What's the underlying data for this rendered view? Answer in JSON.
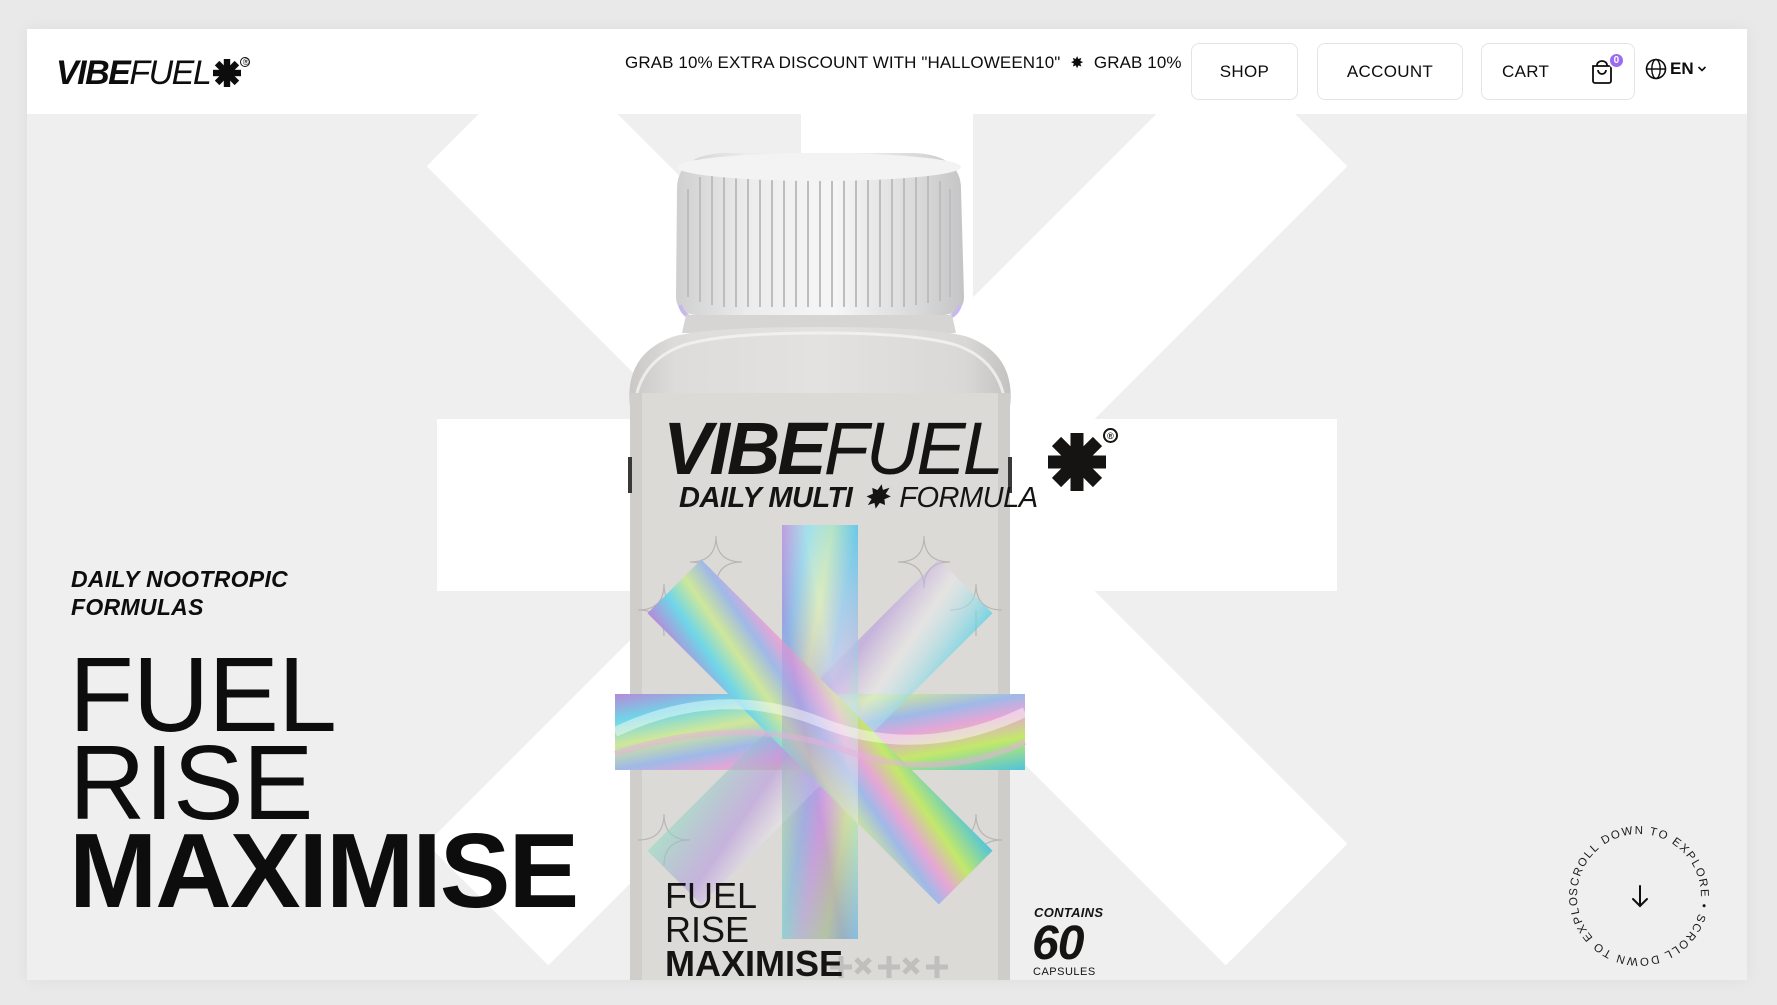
{
  "brand": {
    "logo_bold": "VIBE",
    "logo_light": "FUEL",
    "logo_mark": "asterisk-icon"
  },
  "header": {
    "ticker": [
      "GRAB 10% EXTRA DISCOUNT WITH \"HALLOWEEN10\"",
      "GRAB 10%"
    ],
    "nav": {
      "shop": "SHOP",
      "account": "ACCOUNT",
      "cart": "CART",
      "cart_count": "0"
    },
    "language": "EN"
  },
  "hero": {
    "eyebrow_line1": "DAILY NOOTROPIC",
    "eyebrow_line2": "FORMULAS",
    "headline": [
      "FUEL",
      "RISE",
      "MAXIMISE"
    ]
  },
  "product_label": {
    "brand_bold": "VIBE",
    "brand_light": "FUEL",
    "sub_bold": "DAILY MULTI",
    "sub_light": "FORMULA",
    "tagline": [
      "FUEL",
      "RISE",
      "MAXIMISE"
    ],
    "contains": "CONTAINS",
    "count": "60",
    "unit": "CAPSULES"
  },
  "scroll": {
    "text": "SCROLL DOWN TO EXPLORE • SCROLL DOWN TO EXPLORE •"
  },
  "colors": {
    "accent": "#9b6bf2",
    "background": "#efefef",
    "text": "#0d0d0d"
  }
}
